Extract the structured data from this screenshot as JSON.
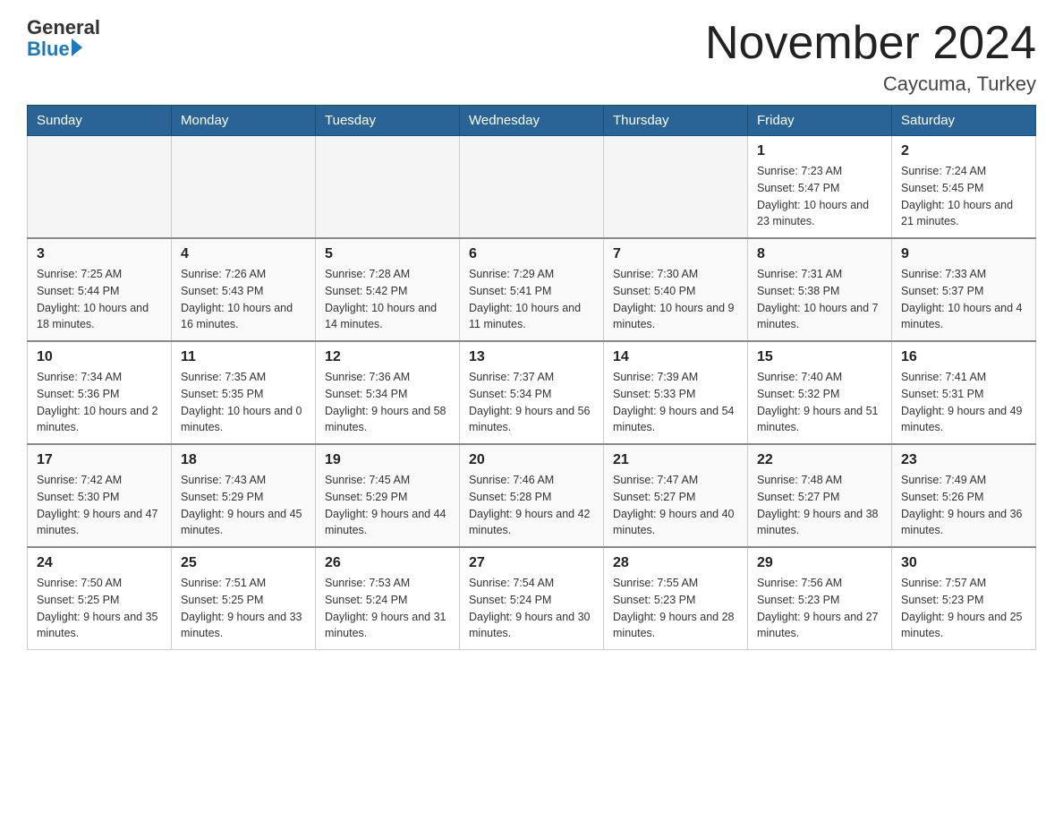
{
  "header": {
    "logo_general": "General",
    "logo_blue": "Blue",
    "month_title": "November 2024",
    "location": "Caycuma, Turkey"
  },
  "weekdays": [
    "Sunday",
    "Monday",
    "Tuesday",
    "Wednesday",
    "Thursday",
    "Friday",
    "Saturday"
  ],
  "weeks": [
    [
      {
        "day": "",
        "sunrise": "",
        "sunset": "",
        "daylight": ""
      },
      {
        "day": "",
        "sunrise": "",
        "sunset": "",
        "daylight": ""
      },
      {
        "day": "",
        "sunrise": "",
        "sunset": "",
        "daylight": ""
      },
      {
        "day": "",
        "sunrise": "",
        "sunset": "",
        "daylight": ""
      },
      {
        "day": "",
        "sunrise": "",
        "sunset": "",
        "daylight": ""
      },
      {
        "day": "1",
        "sunrise": "Sunrise: 7:23 AM",
        "sunset": "Sunset: 5:47 PM",
        "daylight": "Daylight: 10 hours and 23 minutes."
      },
      {
        "day": "2",
        "sunrise": "Sunrise: 7:24 AM",
        "sunset": "Sunset: 5:45 PM",
        "daylight": "Daylight: 10 hours and 21 minutes."
      }
    ],
    [
      {
        "day": "3",
        "sunrise": "Sunrise: 7:25 AM",
        "sunset": "Sunset: 5:44 PM",
        "daylight": "Daylight: 10 hours and 18 minutes."
      },
      {
        "day": "4",
        "sunrise": "Sunrise: 7:26 AM",
        "sunset": "Sunset: 5:43 PM",
        "daylight": "Daylight: 10 hours and 16 minutes."
      },
      {
        "day": "5",
        "sunrise": "Sunrise: 7:28 AM",
        "sunset": "Sunset: 5:42 PM",
        "daylight": "Daylight: 10 hours and 14 minutes."
      },
      {
        "day": "6",
        "sunrise": "Sunrise: 7:29 AM",
        "sunset": "Sunset: 5:41 PM",
        "daylight": "Daylight: 10 hours and 11 minutes."
      },
      {
        "day": "7",
        "sunrise": "Sunrise: 7:30 AM",
        "sunset": "Sunset: 5:40 PM",
        "daylight": "Daylight: 10 hours and 9 minutes."
      },
      {
        "day": "8",
        "sunrise": "Sunrise: 7:31 AM",
        "sunset": "Sunset: 5:38 PM",
        "daylight": "Daylight: 10 hours and 7 minutes."
      },
      {
        "day": "9",
        "sunrise": "Sunrise: 7:33 AM",
        "sunset": "Sunset: 5:37 PM",
        "daylight": "Daylight: 10 hours and 4 minutes."
      }
    ],
    [
      {
        "day": "10",
        "sunrise": "Sunrise: 7:34 AM",
        "sunset": "Sunset: 5:36 PM",
        "daylight": "Daylight: 10 hours and 2 minutes."
      },
      {
        "day": "11",
        "sunrise": "Sunrise: 7:35 AM",
        "sunset": "Sunset: 5:35 PM",
        "daylight": "Daylight: 10 hours and 0 minutes."
      },
      {
        "day": "12",
        "sunrise": "Sunrise: 7:36 AM",
        "sunset": "Sunset: 5:34 PM",
        "daylight": "Daylight: 9 hours and 58 minutes."
      },
      {
        "day": "13",
        "sunrise": "Sunrise: 7:37 AM",
        "sunset": "Sunset: 5:34 PM",
        "daylight": "Daylight: 9 hours and 56 minutes."
      },
      {
        "day": "14",
        "sunrise": "Sunrise: 7:39 AM",
        "sunset": "Sunset: 5:33 PM",
        "daylight": "Daylight: 9 hours and 54 minutes."
      },
      {
        "day": "15",
        "sunrise": "Sunrise: 7:40 AM",
        "sunset": "Sunset: 5:32 PM",
        "daylight": "Daylight: 9 hours and 51 minutes."
      },
      {
        "day": "16",
        "sunrise": "Sunrise: 7:41 AM",
        "sunset": "Sunset: 5:31 PM",
        "daylight": "Daylight: 9 hours and 49 minutes."
      }
    ],
    [
      {
        "day": "17",
        "sunrise": "Sunrise: 7:42 AM",
        "sunset": "Sunset: 5:30 PM",
        "daylight": "Daylight: 9 hours and 47 minutes."
      },
      {
        "day": "18",
        "sunrise": "Sunrise: 7:43 AM",
        "sunset": "Sunset: 5:29 PM",
        "daylight": "Daylight: 9 hours and 45 minutes."
      },
      {
        "day": "19",
        "sunrise": "Sunrise: 7:45 AM",
        "sunset": "Sunset: 5:29 PM",
        "daylight": "Daylight: 9 hours and 44 minutes."
      },
      {
        "day": "20",
        "sunrise": "Sunrise: 7:46 AM",
        "sunset": "Sunset: 5:28 PM",
        "daylight": "Daylight: 9 hours and 42 minutes."
      },
      {
        "day": "21",
        "sunrise": "Sunrise: 7:47 AM",
        "sunset": "Sunset: 5:27 PM",
        "daylight": "Daylight: 9 hours and 40 minutes."
      },
      {
        "day": "22",
        "sunrise": "Sunrise: 7:48 AM",
        "sunset": "Sunset: 5:27 PM",
        "daylight": "Daylight: 9 hours and 38 minutes."
      },
      {
        "day": "23",
        "sunrise": "Sunrise: 7:49 AM",
        "sunset": "Sunset: 5:26 PM",
        "daylight": "Daylight: 9 hours and 36 minutes."
      }
    ],
    [
      {
        "day": "24",
        "sunrise": "Sunrise: 7:50 AM",
        "sunset": "Sunset: 5:25 PM",
        "daylight": "Daylight: 9 hours and 35 minutes."
      },
      {
        "day": "25",
        "sunrise": "Sunrise: 7:51 AM",
        "sunset": "Sunset: 5:25 PM",
        "daylight": "Daylight: 9 hours and 33 minutes."
      },
      {
        "day": "26",
        "sunrise": "Sunrise: 7:53 AM",
        "sunset": "Sunset: 5:24 PM",
        "daylight": "Daylight: 9 hours and 31 minutes."
      },
      {
        "day": "27",
        "sunrise": "Sunrise: 7:54 AM",
        "sunset": "Sunset: 5:24 PM",
        "daylight": "Daylight: 9 hours and 30 minutes."
      },
      {
        "day": "28",
        "sunrise": "Sunrise: 7:55 AM",
        "sunset": "Sunset: 5:23 PM",
        "daylight": "Daylight: 9 hours and 28 minutes."
      },
      {
        "day": "29",
        "sunrise": "Sunrise: 7:56 AM",
        "sunset": "Sunset: 5:23 PM",
        "daylight": "Daylight: 9 hours and 27 minutes."
      },
      {
        "day": "30",
        "sunrise": "Sunrise: 7:57 AM",
        "sunset": "Sunset: 5:23 PM",
        "daylight": "Daylight: 9 hours and 25 minutes."
      }
    ]
  ]
}
